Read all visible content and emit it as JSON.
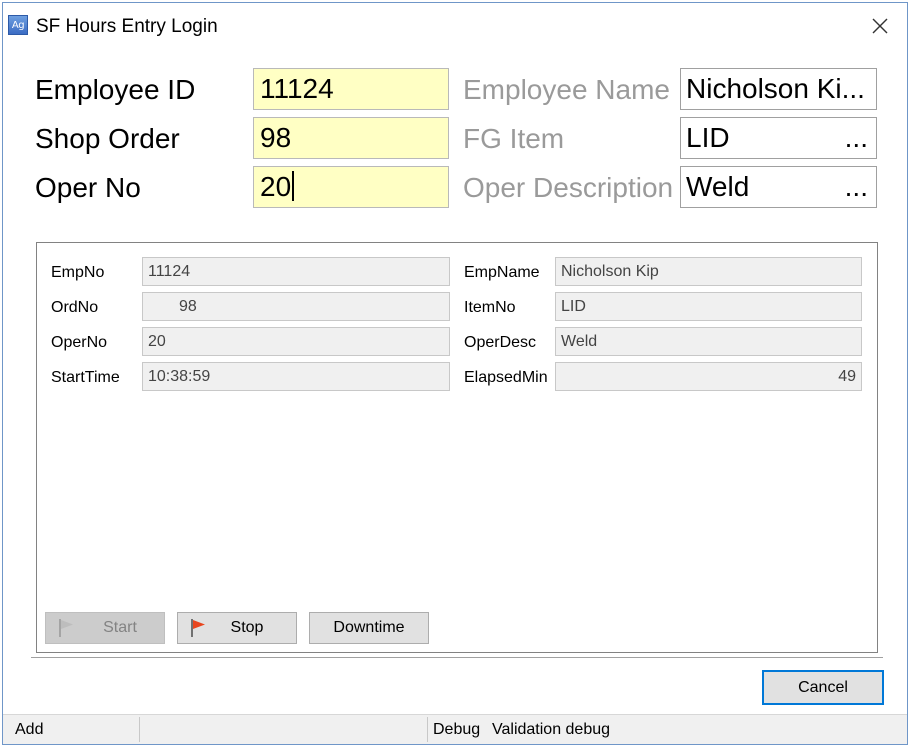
{
  "window": {
    "title": "SF Hours Entry Login",
    "icon": "app-icon",
    "icon_text": "Ag"
  },
  "login_fields": {
    "employee_id": {
      "label": "Employee ID",
      "value": "11124"
    },
    "shop_order": {
      "label": "Shop Order",
      "value": "98"
    },
    "oper_no": {
      "label": "Oper No",
      "value": "20"
    },
    "employee_name": {
      "label": "Employee Name",
      "value": "Nicholson Ki..."
    },
    "fg_item": {
      "label": "FG Item",
      "value": "LID",
      "button": "..."
    },
    "oper_description": {
      "label": "Oper Description",
      "value": "Weld",
      "button": "..."
    }
  },
  "details": {
    "empno": {
      "label": "EmpNo",
      "value": "11124"
    },
    "ordno": {
      "label": "OrdNo",
      "value": "98"
    },
    "operno": {
      "label": "OperNo",
      "value": "20"
    },
    "starttime": {
      "label": "StartTime",
      "value": "10:38:59"
    },
    "empname": {
      "label": "EmpName",
      "value": "Nicholson Kip"
    },
    "itemno": {
      "label": "ItemNo",
      "value": "LID"
    },
    "operdesc": {
      "label": "OperDesc",
      "value": "Weld"
    },
    "elapsedmin": {
      "label": "ElapsedMin",
      "value": "49"
    }
  },
  "actions": {
    "start": {
      "label": "Start",
      "enabled": false
    },
    "stop": {
      "label": "Stop",
      "enabled": true
    },
    "downtime": {
      "label": "Downtime",
      "enabled": true
    }
  },
  "footer": {
    "cancel": "Cancel"
  },
  "statusbar": {
    "mode": "Add",
    "debug": "Debug",
    "validation": "Validation debug"
  },
  "colors": {
    "input_highlight": "#ffffc4",
    "flag_active": "#e8451e",
    "flag_disabled": "#9a9a9a",
    "focus_border": "#0078d7"
  }
}
